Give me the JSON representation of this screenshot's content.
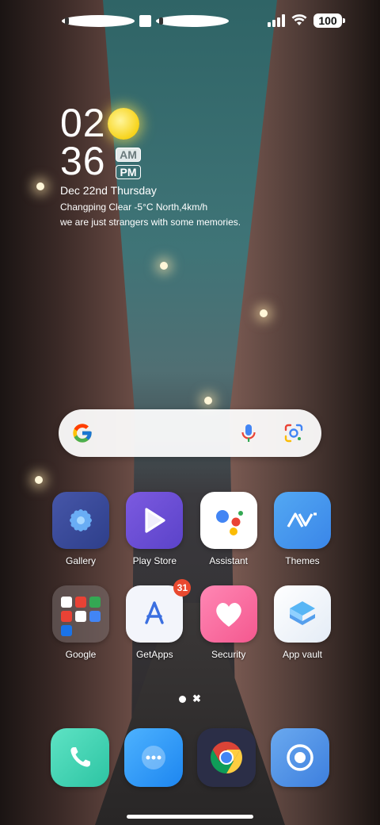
{
  "status_bar": {
    "battery": "100",
    "left_icons": [
      "notification-app-icon",
      "square-icon",
      "notification-app-icon"
    ],
    "right_icons": [
      "signal-icon",
      "wifi-icon",
      "battery-icon"
    ]
  },
  "clock": {
    "hour": "02",
    "minute": "36",
    "am": "AM",
    "pm": "PM",
    "selected_period": "AM",
    "date": "Dec 22nd Thursday",
    "weather": "Changping Clear -5°C North,4km/h",
    "motto": "we are just strangers with some memories."
  },
  "search": {
    "placeholder": ""
  },
  "apps": [
    {
      "label": "Gallery",
      "icon": "gallery-icon"
    },
    {
      "label": "Play Store",
      "icon": "play-store-icon"
    },
    {
      "label": "Assistant",
      "icon": "assistant-icon"
    },
    {
      "label": "Themes",
      "icon": "themes-icon"
    },
    {
      "label": "Google",
      "icon": "folder-icon"
    },
    {
      "label": "GetApps",
      "icon": "getapps-icon",
      "badge": "31"
    },
    {
      "label": "Security",
      "icon": "heart-icon"
    },
    {
      "label": "App vault",
      "icon": "app-vault-icon"
    }
  ],
  "dock": [
    {
      "icon": "phone-icon"
    },
    {
      "icon": "messages-icon"
    },
    {
      "icon": "chrome-icon"
    },
    {
      "icon": "camera-icon"
    }
  ],
  "colors": {
    "badge": "#e9492f",
    "security": "#f4588f",
    "phone": "#2dc4a3"
  }
}
